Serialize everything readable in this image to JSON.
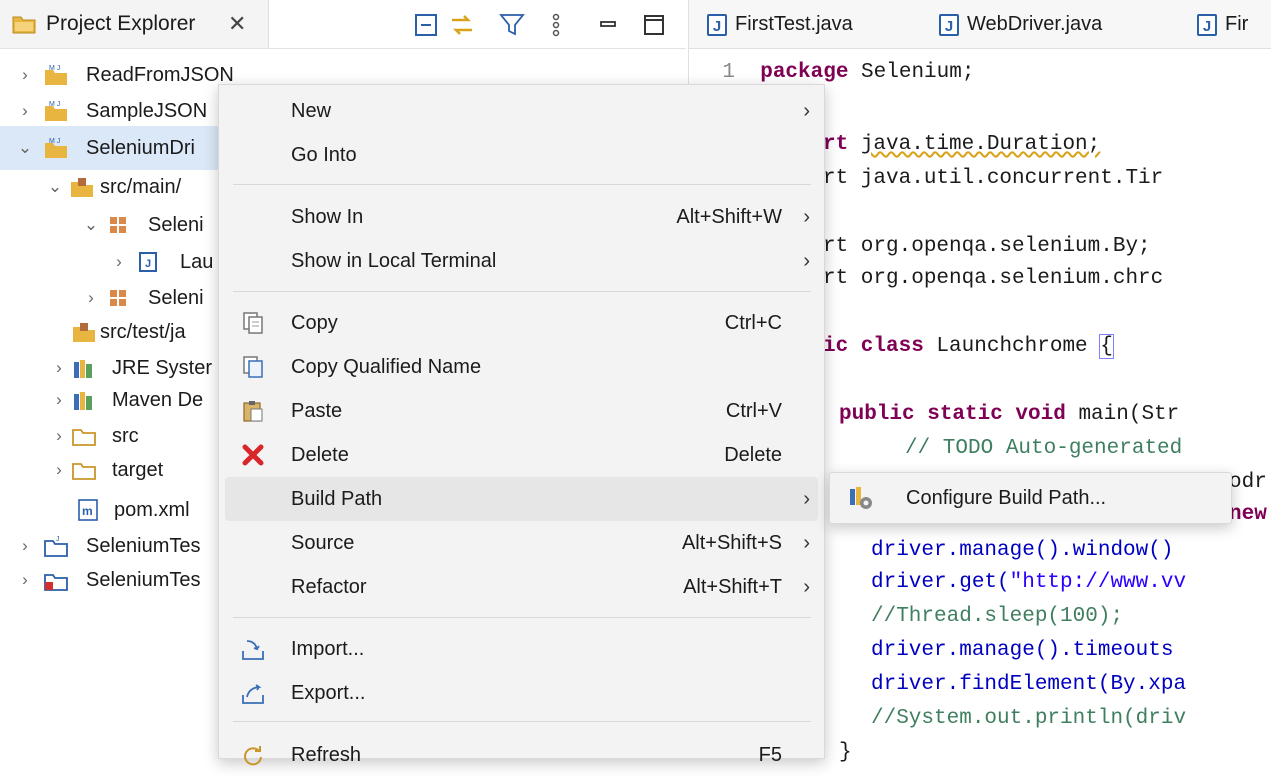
{
  "explorer": {
    "title": "Project Explorer",
    "close": "✕",
    "tree": [
      {
        "label": "ReadFromJSON",
        "icon": "maven-project-icon",
        "expanded": false
      },
      {
        "label": "SampleJSON",
        "icon": "maven-project-icon",
        "expanded": false
      },
      {
        "label": "SeleniumDri",
        "icon": "maven-project-icon",
        "expanded": true,
        "selected": true
      },
      {
        "label": "src/main/",
        "icon": "source-folder-icon",
        "expanded": true
      },
      {
        "label": "Seleni",
        "icon": "package-icon",
        "expanded": true
      },
      {
        "label": "Lau",
        "icon": "java-file-icon",
        "expanded": false
      },
      {
        "label": "Seleni",
        "icon": "package-icon",
        "expanded": false
      },
      {
        "label": "src/test/ja",
        "icon": "source-folder-icon"
      },
      {
        "label": "JRE Syster",
        "icon": "library-icon",
        "expanded": false
      },
      {
        "label": "Maven De",
        "icon": "library-icon",
        "expanded": false
      },
      {
        "label": "src",
        "icon": "folder-icon",
        "expanded": false
      },
      {
        "label": "target",
        "icon": "folder-icon",
        "expanded": false
      },
      {
        "label": "pom.xml",
        "icon": "maven-pom-icon"
      },
      {
        "label": "SeleniumTes",
        "icon": "project-icon",
        "expanded": false
      },
      {
        "label": "SeleniumTes",
        "icon": "project-error-icon",
        "expanded": false
      }
    ]
  },
  "editor": {
    "tabs": [
      "FirstTest.java",
      "WebDriver.java",
      "Fir"
    ],
    "line_number": "1",
    "code": {
      "l1_kw": "package",
      "l1_rest": " Selenium;",
      "l3_a": "rt ",
      "l3_b": "java.time.Duration;",
      "l4": "rt java.util.concurrent.Tir",
      "l6": "rt org.openqa.selenium.By;",
      "l7": "rt org.openqa.selenium.chrc",
      "l9_kw": "ic class",
      "l9_rest": " Launchchrome ",
      "l9_brace": "{",
      "l11_kw": "public static void",
      "l11_rest": " main(Str",
      "l12": "// TODO Auto-generated",
      "l13": "odr",
      "l14": "new",
      "l15": "driver.manage().window()",
      "l16_a": "driver.get(",
      "l16_b": "\"http://www.vv",
      "l17": "//Thread.sleep(100);",
      "l18": "driver.manage().timeouts",
      "l19": "driver.findElement(By.xpa",
      "l20": "//System.out.println(driv",
      "l21": "}"
    }
  },
  "context_menu": {
    "items": [
      {
        "label": "New",
        "shortcut": "",
        "submenu": true
      },
      {
        "label": "Go Into",
        "shortcut": ""
      },
      {
        "label": "Show In",
        "shortcut": "Alt+Shift+W",
        "submenu": true
      },
      {
        "label": "Show in Local Terminal",
        "shortcut": "",
        "submenu": true
      },
      {
        "label": "Copy",
        "shortcut": "Ctrl+C",
        "icon": "copy-icon"
      },
      {
        "label": "Copy Qualified Name",
        "shortcut": "",
        "icon": "copy-qualified-name-icon"
      },
      {
        "label": "Paste",
        "shortcut": "Ctrl+V",
        "icon": "paste-icon"
      },
      {
        "label": "Delete",
        "shortcut": "Delete",
        "icon": "delete-icon"
      },
      {
        "label": "Build Path",
        "shortcut": "",
        "submenu": true,
        "highlighted": true
      },
      {
        "label": "Source",
        "shortcut": "Alt+Shift+S",
        "submenu": true
      },
      {
        "label": "Refactor",
        "shortcut": "Alt+Shift+T",
        "submenu": true
      },
      {
        "label": "Import...",
        "shortcut": "",
        "icon": "import-icon"
      },
      {
        "label": "Export...",
        "shortcut": "",
        "icon": "export-icon"
      },
      {
        "label": "Refresh",
        "shortcut": "F5",
        "icon": "refresh-icon"
      }
    ],
    "arrow": "›"
  },
  "submenu": {
    "label": "Configure Build Path...",
    "icon": "configure-build-path-icon"
  },
  "colors": {
    "keyword": "#7f0055",
    "comment": "#3f7f5f",
    "string": "#2a00ff",
    "selection": "#dbe8f7",
    "menu_bg": "#f3f3f3"
  }
}
